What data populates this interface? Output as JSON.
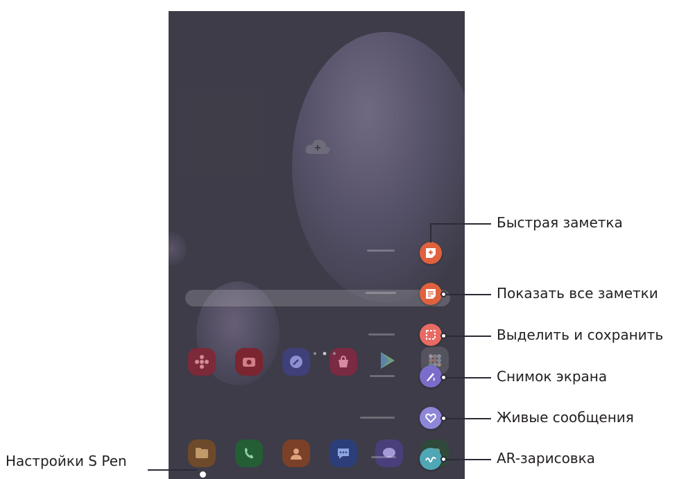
{
  "colors": {
    "wallpaper": "#4c4b57",
    "note_orange": "#e0613e",
    "screenshot_purple": "#7a6cc9",
    "live_message_purple": "#8e86d8",
    "ar_teal": "#4fa6b4",
    "callout_line": "#2b2b36"
  },
  "air_command_menu": [
    {
      "id": "create-note",
      "label": "Быстрая заметка",
      "icon": "note-plus-icon"
    },
    {
      "id": "view-all-notes",
      "label": "Показать все заметки",
      "icon": "notes-list-icon"
    },
    {
      "id": "smart-select",
      "label": "Выделить и сохранить",
      "icon": "selection-frame-icon"
    },
    {
      "id": "screen-write",
      "label": "Снимок экрана",
      "icon": "pen-screen-icon"
    },
    {
      "id": "live-messages",
      "label": "Живые сообщения",
      "icon": "heart-icon"
    },
    {
      "id": "ar-doodle",
      "label": "AR-зарисовка",
      "icon": "squiggle-icon"
    }
  ],
  "settings": {
    "label": "Настройки S Pen",
    "icon": "gear-icon"
  },
  "home_apps_row": [
    "flower-app-icon",
    "camera-app-icon",
    "browser-app-icon",
    "store-app-icon",
    "play-store-icon",
    "apps-folder-icon"
  ],
  "dock_apps": [
    "folder-app-icon",
    "phone-app-icon",
    "contacts-app-icon",
    "messages-app-icon",
    "chat-app-icon",
    "dock-app-icon"
  ]
}
